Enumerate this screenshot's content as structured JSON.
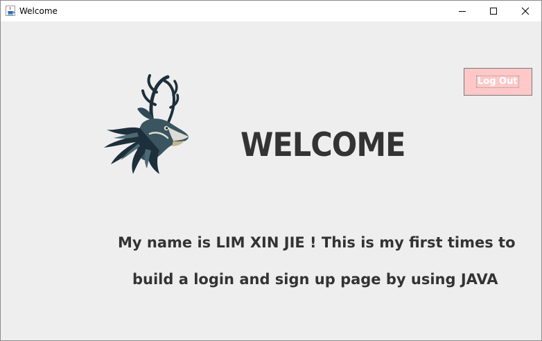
{
  "window": {
    "title": "Welcome",
    "app_icon": "java-cup-icon",
    "controls": [
      "minimize-icon",
      "maximize-icon",
      "close-icon"
    ]
  },
  "main": {
    "logo_icon": "deer-logo",
    "heading": "WELCOME",
    "logout_label": "Log Out",
    "logout_color": "#ffc8c8",
    "bio_line_1": "My name is LIM XIN JIE ! This is my first times to",
    "bio_line_2": "build a login and sign up page by using  JAVA"
  }
}
